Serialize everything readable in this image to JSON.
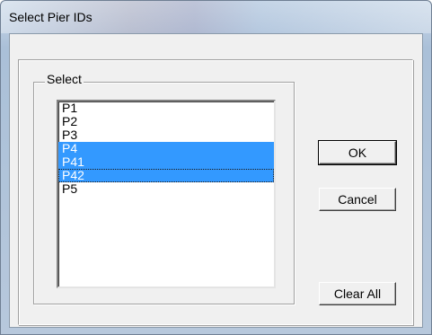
{
  "window": {
    "title": "Select Pier IDs"
  },
  "group": {
    "label": "Select"
  },
  "list": {
    "items": [
      {
        "label": "P1",
        "selected": false
      },
      {
        "label": "P2",
        "selected": false
      },
      {
        "label": "P3",
        "selected": false
      },
      {
        "label": "P4",
        "selected": true
      },
      {
        "label": "P41",
        "selected": true
      },
      {
        "label": "P42",
        "selected": true,
        "focused": true
      },
      {
        "label": "P5",
        "selected": false
      }
    ]
  },
  "buttons": {
    "ok": "OK",
    "cancel": "Cancel",
    "clear_all": "Clear All"
  },
  "colors": {
    "selection": "#3399ff",
    "dialog_bg": "#f0f0f0"
  }
}
